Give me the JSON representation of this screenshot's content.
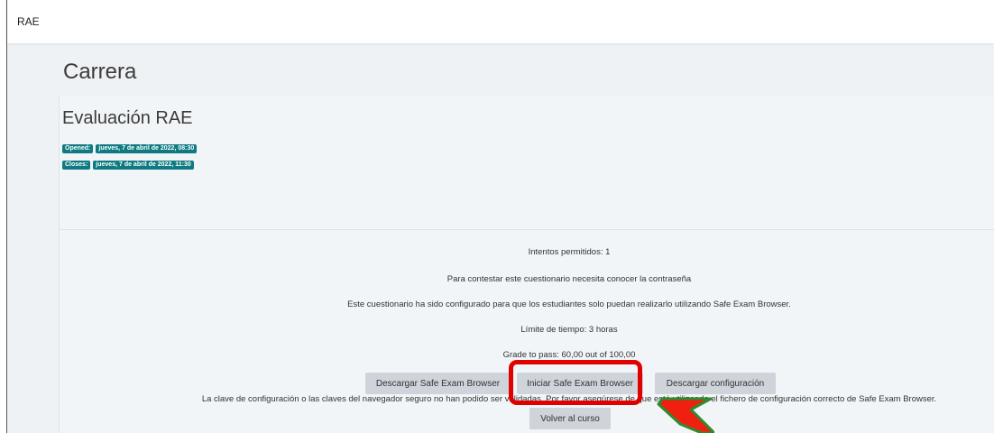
{
  "header": {
    "brand": "RAE"
  },
  "page": {
    "course_title": "Carrera",
    "quiz_title": "Evaluación RAE"
  },
  "dates": {
    "opened_label": "Opened:",
    "opened_value": "jueves, 7 de abril de 2022, 08:30",
    "closes_label": "Closes:",
    "closes_value": "jueves, 7 de abril de 2022, 11:30"
  },
  "quiz_info": {
    "attempts": "Intentos permitidos: 1",
    "password": "Para contestar este cuestionario necesita conocer la contraseña",
    "seb_required": "Este cuestionario ha sido configurado para que los estudiantes solo puedan realizarlo utilizando Safe Exam Browser.",
    "time_limit": "Límite de tiempo: 3 horas",
    "grade_to_pass": "Grade to pass: 60,00 out of 100,00",
    "config_warning": "La clave de configuración o las claves del navegador seguro no han podido ser validadas. Por favor asegúrese de que está utilizando el fichero de configuración correcto de Safe Exam Browser."
  },
  "buttons": {
    "download_seb": "Descargar Safe Exam Browser",
    "launch_seb": "Iniciar Safe Exam Browser",
    "download_config": "Descargar configuración",
    "back_to_course": "Volver al curso"
  },
  "colors": {
    "badge": "#0f7a82",
    "button_bg": "#ced4da",
    "highlight": "#e00000",
    "arrow_fill": "#f02010",
    "arrow_outline": "#2e8b2e",
    "page_bg": "#eef2f4"
  },
  "annotation": {
    "arrow_icon": "arrow-up-left-icon"
  }
}
